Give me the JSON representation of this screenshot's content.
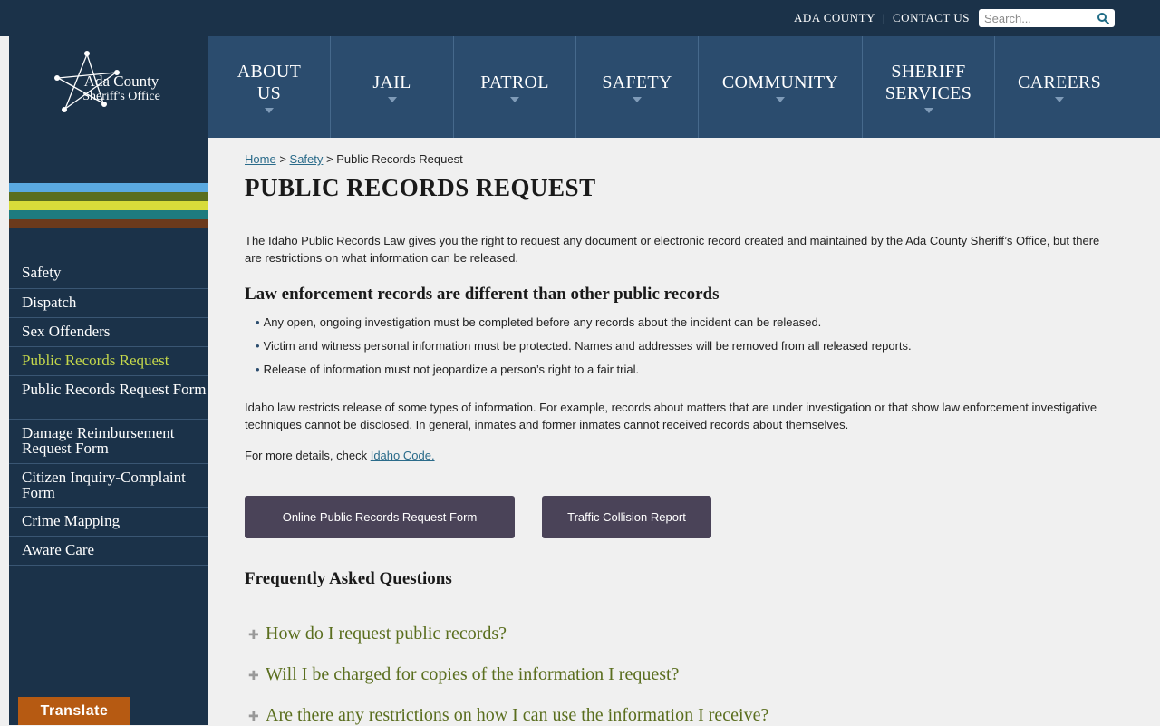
{
  "header": {
    "util_links": [
      "ADA COUNTY",
      "CONTACT US"
    ],
    "search_placeholder": "Search...",
    "logo_line1": "Ada County",
    "logo_line2": "Sheriff's Office"
  },
  "nav": {
    "items": [
      {
        "label": "ABOUT US",
        "line1": "ABOUT",
        "line2": "US"
      },
      {
        "label": "JAIL",
        "line1": "JAIL",
        "line2": ""
      },
      {
        "label": "PATROL",
        "line1": "PATROL",
        "line2": ""
      },
      {
        "label": "SAFETY",
        "line1": "SAFETY",
        "line2": ""
      },
      {
        "label": "COMMUNITY",
        "line1": "COMMUNITY",
        "line2": ""
      },
      {
        "label": "SHERIFF SERVICES",
        "line1": "SHERIFF",
        "line2": "SERVICES"
      },
      {
        "label": "CAREERS",
        "line1": "CAREERS",
        "line2": ""
      }
    ]
  },
  "colors": {
    "stripes": [
      "#5aa9e0",
      "#5a6e1e",
      "#d8dc3a",
      "#1e7b7f",
      "#6b3a1c"
    ],
    "topbar": "#1b3249",
    "nav": "#2b4c6e",
    "button": "#4a4358",
    "translate": "#b65a12",
    "active_link": "#c5d84b"
  },
  "sidebar": {
    "items": [
      {
        "label": "Safety",
        "active": false
      },
      {
        "label": "Dispatch",
        "active": false
      },
      {
        "label": "Sex Offenders",
        "active": false
      },
      {
        "label": "Public Records Request",
        "active": true
      },
      {
        "label": "Public Records Request Form",
        "active": false
      },
      {
        "label": "Damage Reimbursement Request Form",
        "active": false
      },
      {
        "label": "Citizen Inquiry-Complaint Form",
        "active": false
      },
      {
        "label": "Crime Mapping",
        "active": false
      },
      {
        "label": "Aware Care",
        "active": false
      }
    ]
  },
  "translate_label": "Translate",
  "breadcrumb": {
    "home": "Home",
    "sep": ">",
    "section": "Safety",
    "current": "Public Records Request"
  },
  "page_title": "PUBLIC RECORDS REQUEST",
  "intro": "The Idaho Public Records Law gives you the right to request any document or electronic record created and maintained by the Ada County Sheriff’s Office, but there are restrictions on what information can be released.",
  "section_heading": "Law enforcement records are different than other public records",
  "bullets": [
    "Any open, ongoing investigation must be completed before any records about the incident can be released.",
    "Victim and witness personal information must be protected. Names and addresses will be removed from all released reports.",
    "Release of information must not jeopardize a person’s right to a fair trial."
  ],
  "para2": "Idaho law restricts release of some types of information. For example, records about matters that are under investigation or that show law enforcement investigative techniques cannot be disclosed. In general, inmates and former inmates cannot received records about themselves.",
  "para3_prefix": "For more details, check ",
  "para3_link": "Idaho Code.",
  "buttons": {
    "records_form": "Online Public Records Request Form",
    "collision": "Traffic Collision Report"
  },
  "faq_title": "Frequently Asked Questions",
  "faqs": [
    "How do I request public records?",
    "Will I be charged for copies of the information I request?",
    "Are there any restrictions on how I can use the information I receive?"
  ]
}
